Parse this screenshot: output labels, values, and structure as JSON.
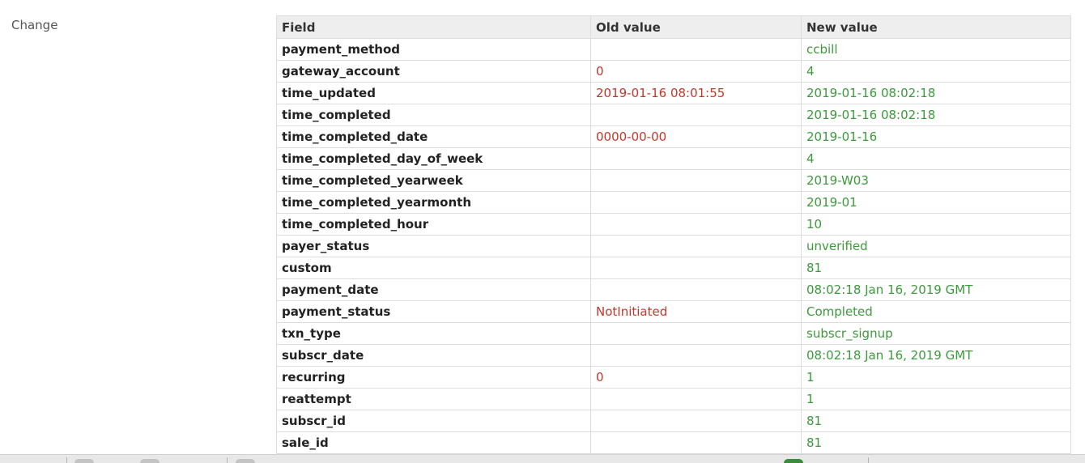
{
  "section": {
    "label": "Change"
  },
  "table": {
    "headers": {
      "field": "Field",
      "old": "Old value",
      "new": "New value"
    },
    "rows": [
      {
        "field": "payment_method",
        "old": "",
        "new": "ccbill"
      },
      {
        "field": "gateway_account",
        "old": "0",
        "new": "4"
      },
      {
        "field": "time_updated",
        "old": "2019-01-16 08:01:55",
        "new": "2019-01-16 08:02:18"
      },
      {
        "field": "time_completed",
        "old": "",
        "new": "2019-01-16 08:02:18"
      },
      {
        "field": "time_completed_date",
        "old": "0000-00-00",
        "new": "2019-01-16"
      },
      {
        "field": "time_completed_day_of_week",
        "old": "",
        "new": "4"
      },
      {
        "field": "time_completed_yearweek",
        "old": "",
        "new": "2019-W03"
      },
      {
        "field": "time_completed_yearmonth",
        "old": "",
        "new": "2019-01"
      },
      {
        "field": "time_completed_hour",
        "old": "",
        "new": "10"
      },
      {
        "field": "payer_status",
        "old": "",
        "new": "unverified"
      },
      {
        "field": "custom",
        "old": "",
        "new": "81"
      },
      {
        "field": "payment_date",
        "old": "",
        "new": "08:02:18 Jan 16, 2019 GMT"
      },
      {
        "field": "payment_status",
        "old": "NotInitiated",
        "new": "Completed"
      },
      {
        "field": "txn_type",
        "old": "",
        "new": "subscr_signup"
      },
      {
        "field": "subscr_date",
        "old": "",
        "new": "08:02:18 Jan 16, 2019 GMT"
      },
      {
        "field": "recurring",
        "old": "0",
        "new": "1"
      },
      {
        "field": "reattempt",
        "old": "",
        "new": "1"
      },
      {
        "field": "subscr_id",
        "old": "",
        "new": "81"
      },
      {
        "field": "sale_id",
        "old": "",
        "new": "81"
      }
    ]
  },
  "colors": {
    "old_value": "#c0392b",
    "new_value": "#3c9a3c",
    "header_bg": "#eeeeee",
    "border": "#dddddd"
  }
}
